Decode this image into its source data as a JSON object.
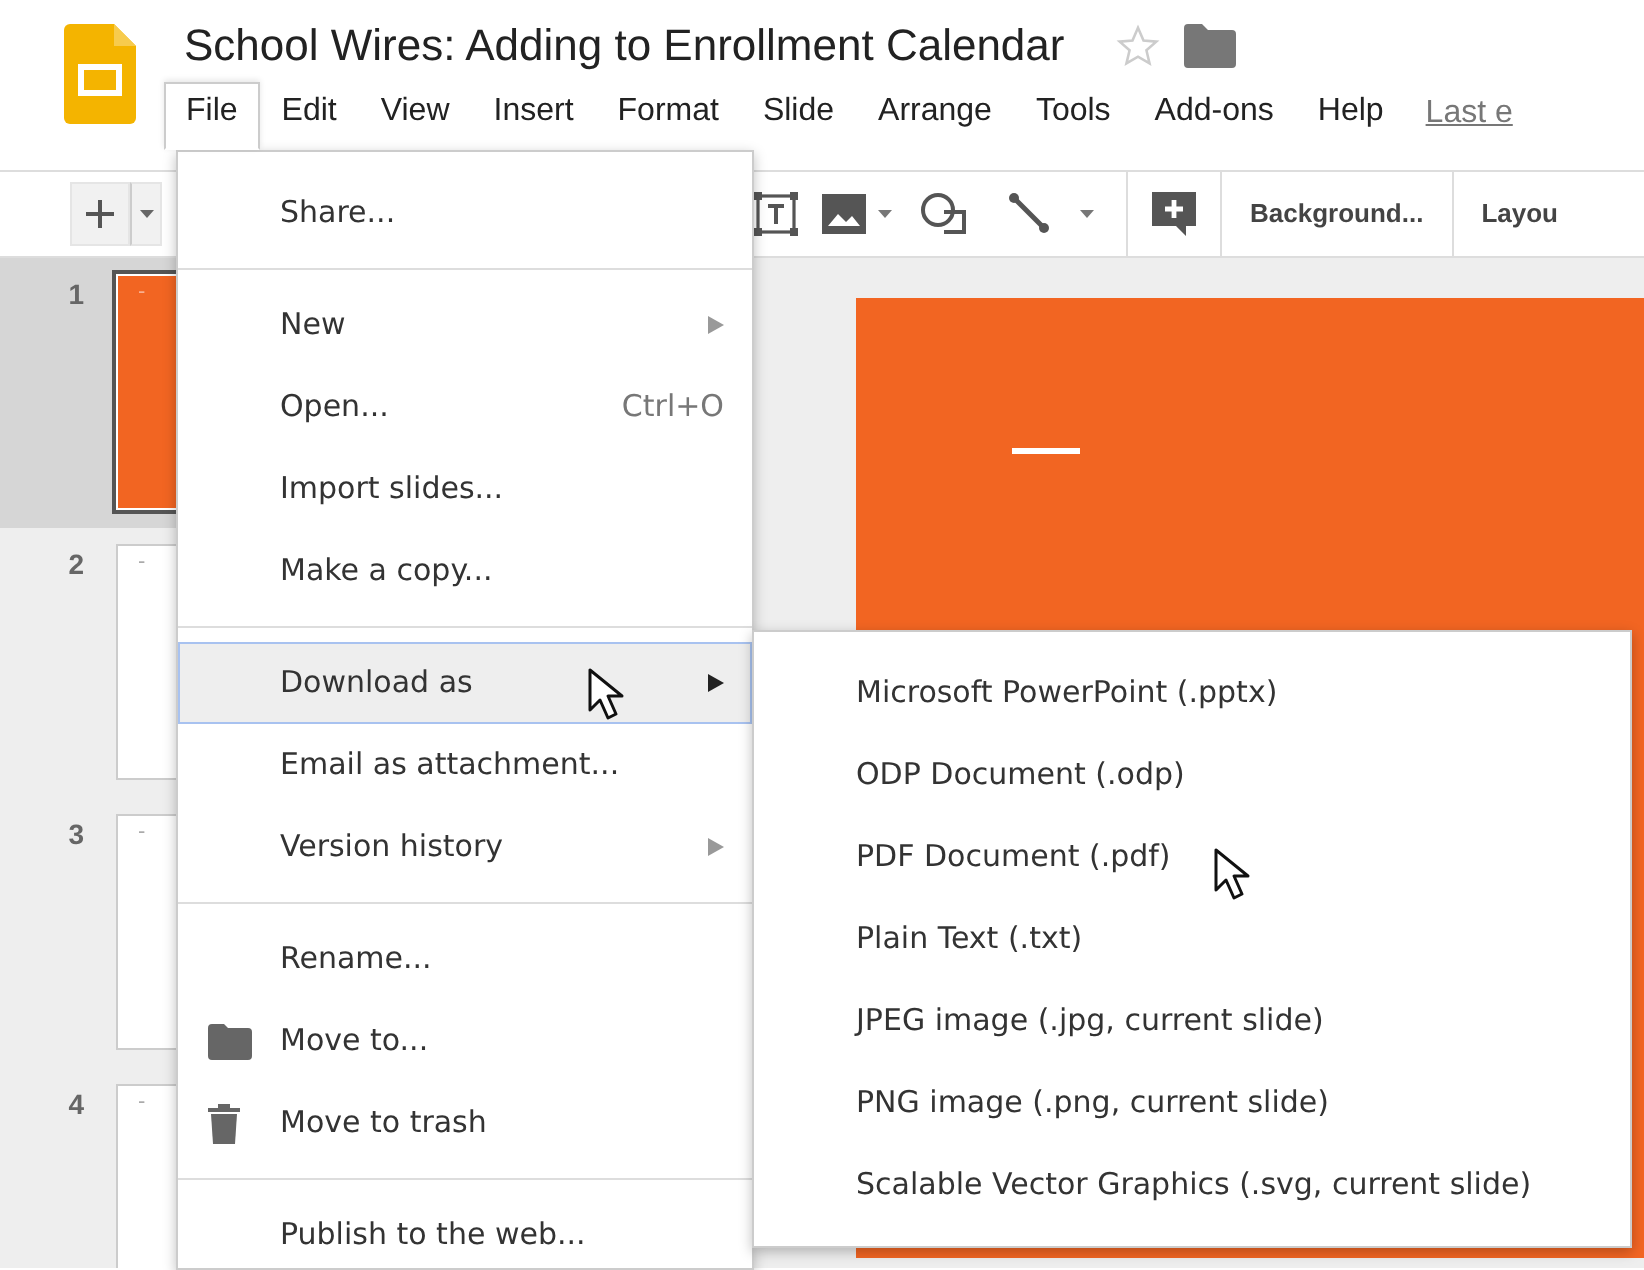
{
  "app": {
    "title": "School Wires: Adding to Enrollment Calendar",
    "starred": false
  },
  "menu_bar": [
    {
      "label": "File",
      "open": true
    },
    {
      "label": "Edit",
      "open": false
    },
    {
      "label": "View",
      "open": false
    },
    {
      "label": "Insert",
      "open": false
    },
    {
      "label": "Format",
      "open": false
    },
    {
      "label": "Slide",
      "open": false
    },
    {
      "label": "Arrange",
      "open": false
    },
    {
      "label": "Tools",
      "open": false
    },
    {
      "label": "Add-ons",
      "open": false
    },
    {
      "label": "Help",
      "open": false
    }
  ],
  "last_edit": "Last e",
  "toolbar": {
    "background_button": "Background...",
    "layout_button": "Layou"
  },
  "slides": [
    {
      "number": "1",
      "selected": true,
      "color": "#f26522",
      "mark": "-"
    },
    {
      "number": "2",
      "selected": false,
      "color": "#ffffff",
      "mark": "-"
    },
    {
      "number": "3",
      "selected": false,
      "color": "#ffffff",
      "mark": "-"
    },
    {
      "number": "4",
      "selected": false,
      "color": "#ffffff",
      "mark": "-"
    }
  ],
  "file_menu": [
    [
      {
        "label": "Share...",
        "kind": "plain",
        "submenu": false,
        "highlighted": false
      }
    ],
    [
      {
        "label": "New",
        "kind": "plain",
        "submenu": true,
        "highlighted": false
      },
      {
        "label": "Open...",
        "kind": "plain",
        "shortcut": "Ctrl+O",
        "submenu": false,
        "highlighted": false
      },
      {
        "label": "Import slides...",
        "kind": "plain",
        "submenu": false,
        "highlighted": false
      },
      {
        "label": "Make a copy...",
        "kind": "plain",
        "submenu": false,
        "highlighted": false
      }
    ],
    [
      {
        "label": "Download as",
        "kind": "plain",
        "submenu": true,
        "highlighted": true
      },
      {
        "label": "Email as attachment...",
        "kind": "plain",
        "submenu": false,
        "highlighted": false
      },
      {
        "label": "Version history",
        "kind": "plain",
        "submenu": true,
        "highlighted": false
      }
    ],
    [
      {
        "label": "Rename...",
        "kind": "plain",
        "submenu": false,
        "highlighted": false
      },
      {
        "label": "Move to...",
        "kind": "folder",
        "submenu": false,
        "highlighted": false
      },
      {
        "label": "Move to trash",
        "kind": "trash",
        "submenu": false,
        "highlighted": false
      }
    ],
    [
      {
        "label": "Publish to the web...",
        "kind": "plain",
        "submenu": false,
        "highlighted": false
      }
    ]
  ],
  "download_submenu": [
    "Microsoft PowerPoint (.pptx)",
    "ODP Document (.odp)",
    "PDF Document (.pdf)",
    "Plain Text (.txt)",
    "JPEG image (.jpg, current slide)",
    "PNG image (.png, current slide)",
    "Scalable Vector Graphics (.svg, current slide)"
  ]
}
